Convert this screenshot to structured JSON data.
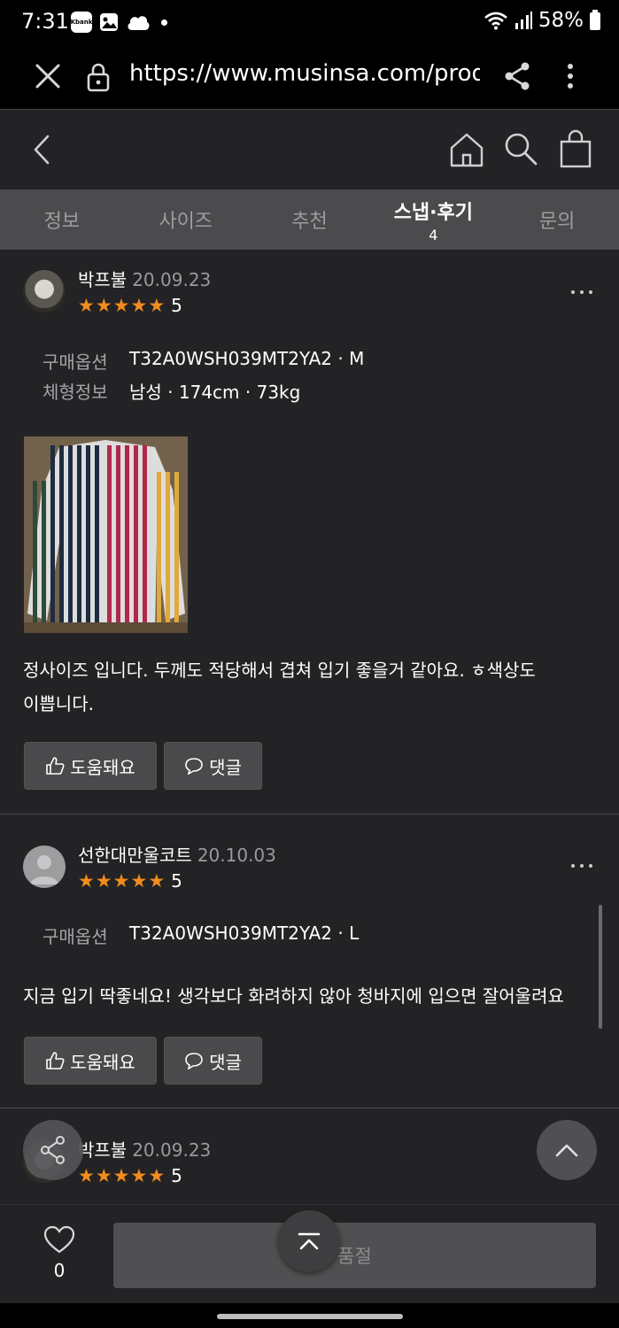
{
  "status_bar": {
    "time": "7:31",
    "app_icon_label": "Kbank",
    "battery": "58%",
    "icons": [
      "kbank-icon",
      "gallery-icon",
      "cloud-icon",
      "notification-dot",
      "wifi-icon",
      "signal-icon",
      "battery-icon"
    ]
  },
  "browser": {
    "url": "https://www.musinsa.com/product/",
    "icons": [
      "close-icon",
      "lock-icon",
      "share-icon",
      "more-vertical-icon"
    ]
  },
  "header": {
    "icons": [
      "back-icon",
      "home-icon",
      "search-icon",
      "shopping-bag-icon"
    ]
  },
  "tabs": [
    {
      "label": "정보",
      "count": ""
    },
    {
      "label": "사이즈",
      "count": ""
    },
    {
      "label": "추천",
      "count": ""
    },
    {
      "label": "스냅·후기",
      "count": "4"
    },
    {
      "label": "문의",
      "count": ""
    }
  ],
  "active_tab": 3,
  "reviews": [
    {
      "name": "박프불",
      "date": "20.09.23",
      "rating": "5",
      "option_label": "구매옵션",
      "option_value": "T32A0WSH039MT2YA2 · M",
      "body_label": "체형정보",
      "body_value": "남성 · 174cm · 73kg",
      "text_line1": "정사이즈 입니다. 두께도 적당해서 겹쳐 입기 좋을거 같아요. ㅎ색상도",
      "text_line2": "이쁩니다.",
      "helpful_label": "도움돼요",
      "comment_label": "댓글"
    },
    {
      "name": "선한대만울코트",
      "date": "20.10.03",
      "rating": "5",
      "option_label": "구매옵션",
      "option_value": "T32A0WSH039MT2YA2 · L",
      "text_line1": "지금 입기 딱좋네요! 생각보다 화려하지 않아 청바지에 입으면 잘어울려요",
      "helpful_label": "도움돼요",
      "comment_label": "댓글"
    },
    {
      "name": "박프불",
      "date": "20.09.23",
      "rating": "5"
    }
  ],
  "bottom": {
    "like_count": "0",
    "buy_label": "품절"
  },
  "colors": {
    "background": "#232325",
    "tab_bar": "#4b4b4d",
    "star": "#f28c1e",
    "button": "#4a4a4c"
  }
}
